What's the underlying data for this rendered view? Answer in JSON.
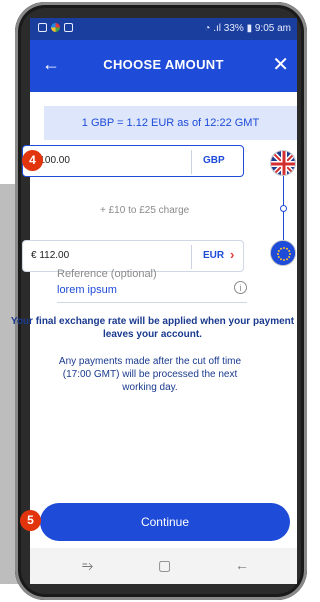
{
  "status_bar": {
    "right": "◔ .ıl 33% ▮ 9:05 am"
  },
  "header": {
    "back_icon": "←",
    "title": "CHOOSE AMOUNT",
    "close_icon": "✕"
  },
  "rate_banner": "1 GBP = 1.12 EUR as of 12:22 GMT",
  "from_field": {
    "amount": "£ 100.00",
    "currency": "GBP"
  },
  "charge_text": "+ £10 to £25 charge",
  "to_field": {
    "amount": "€ 112.00",
    "currency": "EUR",
    "chevron": "›"
  },
  "reference": {
    "label": "Reference (optional)",
    "value": "lorem ipsum",
    "info_icon": "i"
  },
  "notices": {
    "primary": "Your final exchange rate will be applied when your payment leaves your account.",
    "secondary": "Any payments made after the cut off time (17:00 GMT) will be processed the next working day."
  },
  "continue_label": "Continue",
  "step_badges": {
    "amount_step": "4",
    "continue_step": "5"
  },
  "nav_bar": {
    "recents_icon": "⥱",
    "home_icon": "▢",
    "back_icon": "←"
  },
  "colors": {
    "primary": "#1e4bd8",
    "status_bar": "#1a3e9e",
    "banner": "#dde6fb",
    "accent": "#e53935",
    "badge": "#e2350e"
  }
}
